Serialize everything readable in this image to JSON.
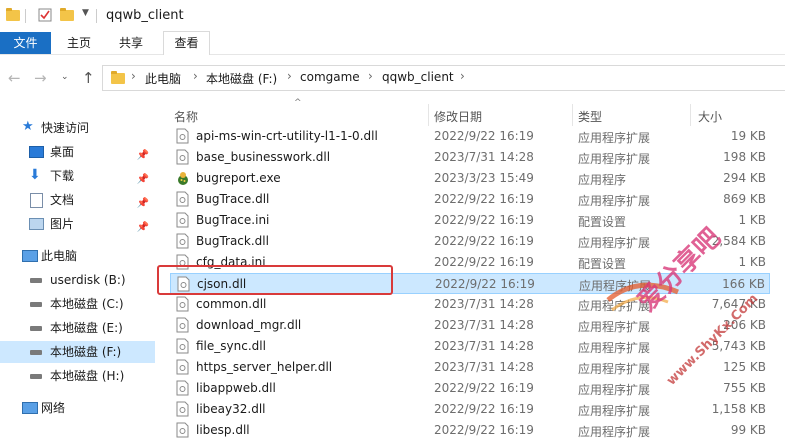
{
  "window": {
    "title": "qqwb_client"
  },
  "ribbon": {
    "tabs": [
      {
        "label": "文件"
      },
      {
        "label": "主页"
      },
      {
        "label": "共享"
      },
      {
        "label": "查看"
      }
    ]
  },
  "address": {
    "crumbs": [
      "此电脑",
      "本地磁盘 (F:)",
      "comgame",
      "qqwb_client"
    ]
  },
  "sidebar": {
    "quick_access": "快速访问",
    "pinned": [
      "桌面",
      "下载",
      "文档",
      "图片"
    ],
    "this_pc": "此电脑",
    "drives": [
      "userdisk (B:)",
      "本地磁盘 (C:)",
      "本地磁盘 (E:)",
      "本地磁盘 (F:)",
      "本地磁盘 (H:)"
    ],
    "network": "网络"
  },
  "columns": {
    "name": "名称",
    "date": "修改日期",
    "type": "类型",
    "size": "大小"
  },
  "files": [
    {
      "name": "api-ms-win-crt-utility-l1-1-0.dll",
      "date": "2022/9/22 16:19",
      "type": "应用程序扩展",
      "size": "19 KB",
      "icon": "dll-icon"
    },
    {
      "name": "base_businesswork.dll",
      "date": "2023/7/31 14:28",
      "type": "应用程序扩展",
      "size": "198 KB",
      "icon": "dll-icon"
    },
    {
      "name": "bugreport.exe",
      "date": "2023/3/23 15:49",
      "type": "应用程序",
      "size": "294 KB",
      "icon": "exe-icon"
    },
    {
      "name": "BugTrace.dll",
      "date": "2022/9/22 16:19",
      "type": "应用程序扩展",
      "size": "869 KB",
      "icon": "dll-icon"
    },
    {
      "name": "BugTrace.ini",
      "date": "2022/9/22 16:19",
      "type": "配置设置",
      "size": "1 KB",
      "icon": "ini-icon"
    },
    {
      "name": "BugTrack.dll",
      "date": "2022/9/22 16:19",
      "type": "应用程序扩展",
      "size": "2,584 KB",
      "icon": "dll-icon"
    },
    {
      "name": "cfg_data.ini",
      "date": "2022/9/22 16:19",
      "type": "配置设置",
      "size": "1 KB",
      "icon": "ini-icon"
    },
    {
      "name": "cjson.dll",
      "date": "2022/9/22 16:19",
      "type": "应用程序扩展",
      "size": "166 KB",
      "icon": "dll-icon"
    },
    {
      "name": "common.dll",
      "date": "2023/7/31 14:28",
      "type": "应用程序扩展",
      "size": "7,647 KB",
      "icon": "dll-icon"
    },
    {
      "name": "download_mgr.dll",
      "date": "2023/7/31 14:28",
      "type": "应用程序扩展",
      "size": "206 KB",
      "icon": "dll-icon"
    },
    {
      "name": "file_sync.dll",
      "date": "2023/7/31 14:28",
      "type": "应用程序扩展",
      "size": "5,743 KB",
      "icon": "dll-icon"
    },
    {
      "name": "https_server_helper.dll",
      "date": "2023/7/31 14:28",
      "type": "应用程序扩展",
      "size": "125 KB",
      "icon": "dll-icon"
    },
    {
      "name": "libappweb.dll",
      "date": "2022/9/22 16:19",
      "type": "应用程序扩展",
      "size": "755 KB",
      "icon": "dll-icon"
    },
    {
      "name": "libeay32.dll",
      "date": "2022/9/22 16:19",
      "type": "应用程序扩展",
      "size": "1,158 KB",
      "icon": "dll-icon"
    },
    {
      "name": "libesp.dll",
      "date": "2022/9/22 16:19",
      "type": "应用程序扩展",
      "size": "99 KB",
      "icon": "dll-icon"
    }
  ],
  "selected_index": 7,
  "watermark": {
    "line1": "爱分享吧",
    "line2": "www.ShyKx.Com"
  },
  "colors": {
    "accent": "#1a6fc4",
    "selection": "#cce8ff",
    "highlight": "#d93a3a"
  }
}
